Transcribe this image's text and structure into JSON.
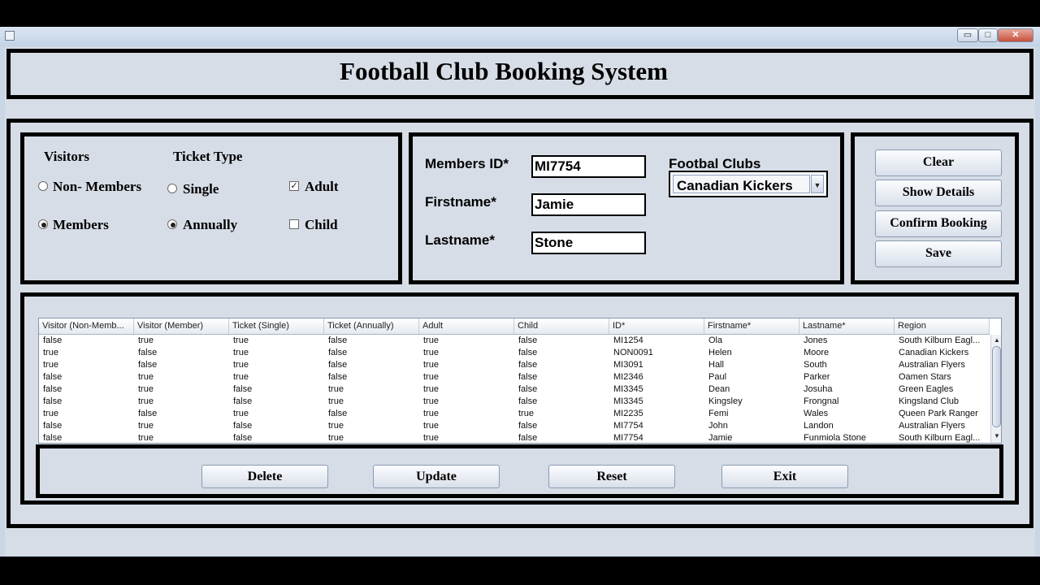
{
  "window": {
    "title": "",
    "controls": {
      "minimize": "▭",
      "maximize": "□",
      "close": "✕"
    }
  },
  "header": {
    "title": "Football Club Booking System"
  },
  "options": {
    "visitors_label": "Visitors",
    "ticket_type_label": "Ticket Type",
    "non_members": "Non- Members",
    "members": "Members",
    "single": "Single",
    "annually": "Annually",
    "adult": "Adult",
    "child": "Child",
    "selected_visitor": "Members",
    "selected_ticket": "Annually",
    "adult_checked": true,
    "child_checked": false
  },
  "member": {
    "id_label": "Members ID*",
    "id_value": "MI7754",
    "firstname_label": "Firstname*",
    "firstname_value": "Jamie",
    "lastname_label": "Lastname*",
    "lastname_value": "Stone",
    "clubs_label": "Footbal Clubs",
    "club_selected": "Canadian Kickers"
  },
  "actions": {
    "clear": "Clear",
    "show_details": "Show Details",
    "confirm_booking": "Confirm Booking",
    "save": "Save"
  },
  "table": {
    "columns": [
      "Visitor (Non-Memb...",
      "Visitor (Member)",
      "Ticket (Single)",
      "Ticket (Annually)",
      "Adult",
      "Child",
      "ID*",
      "Firstname*",
      "Lastname*",
      "Region"
    ],
    "rows": [
      [
        "false",
        "true",
        "true",
        "false",
        "true",
        "false",
        "MI1254",
        "Ola",
        "Jones",
        "South Kilburn Eagl..."
      ],
      [
        "true",
        "false",
        "true",
        "false",
        "true",
        "false",
        "NON0091",
        "Helen",
        "Moore",
        "Canadian Kickers"
      ],
      [
        "true",
        "false",
        "true",
        "false",
        "true",
        "false",
        "MI3091",
        "Hall",
        "South",
        "Australian Flyers"
      ],
      [
        "false",
        "true",
        "true",
        "false",
        "true",
        "false",
        "MI2346",
        "Paul",
        "Parker",
        "Oamen Stars"
      ],
      [
        "false",
        "true",
        "false",
        "true",
        "true",
        "false",
        "MI3345",
        "Dean",
        "Josuha",
        "Green Eagles"
      ],
      [
        "false",
        "true",
        "false",
        "true",
        "true",
        "false",
        "MI3345",
        "Kingsley",
        "Frongnal",
        "Kingsland Club"
      ],
      [
        "true",
        "false",
        "true",
        "false",
        "true",
        "true",
        "MI2235",
        "Femi",
        "Wales",
        "Queen Park Ranger"
      ],
      [
        "false",
        "true",
        "false",
        "true",
        "true",
        "false",
        "MI7754",
        "John",
        "Landon",
        "Australian Flyers"
      ],
      [
        "false",
        "true",
        "false",
        "true",
        "true",
        "false",
        "MI7754",
        "Jamie",
        "Funmiola Stone",
        "South Kilburn Eagl..."
      ]
    ]
  },
  "bottom": {
    "delete": "Delete",
    "update": "Update",
    "reset": "Reset",
    "exit": "Exit"
  }
}
